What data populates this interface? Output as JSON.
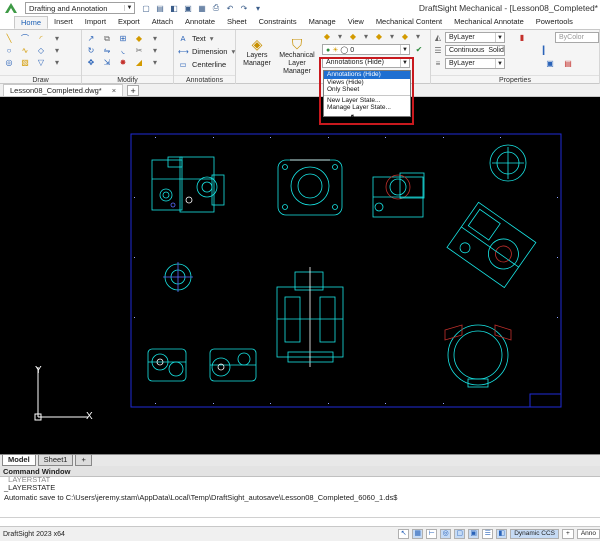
{
  "titlebar": {
    "workspace": "Drafting and Annotation",
    "window_title": "DraftSight Mechanical - [Lesson08_Completed*"
  },
  "ribbon_tabs": [
    "Home",
    "Insert",
    "Import",
    "Export",
    "Attach",
    "Annotate",
    "Sheet",
    "Constraints",
    "Manage",
    "View",
    "Mechanical Content",
    "Mechanical Annotate",
    "Powertools"
  ],
  "ribbon": {
    "draw_label": "Draw",
    "modify_label": "Modify",
    "annotations_label": "Annotations",
    "properties_label": "Properties",
    "text_label": "Text",
    "dimension_label": "Dimension",
    "centerline_label": "Centerline",
    "layers_manager_label": "Layers Manager",
    "mech_layer_manager_label": "Mechanical Layer Manager",
    "layer_combo_value": "0",
    "layer_state_value": "Annotations (Hide)",
    "color_value": "ByLayer",
    "linetype_value": "Continuous",
    "linestyle_value": "Solid",
    "lineweight_value": "ByLayer",
    "bycolor_value": "ByColor"
  },
  "layer_state_dropdown": {
    "items": [
      "Annotations (Hide)",
      "Views (Hide)",
      "Only Sheet",
      "New Layer State...",
      "Manage Layer State..."
    ],
    "selected_index": 0
  },
  "doc_tab": {
    "name": "Lesson08_Completed.dwg*",
    "close": "×",
    "add": "+"
  },
  "canvas": {
    "ucs_x": "X",
    "ucs_y": "Y"
  },
  "layout_tabs": [
    "Model",
    "Sheet1",
    "+"
  ],
  "command_window": {
    "title": "Command Window",
    "lines": [
      "_LAYERSTATE",
      "Automatic save to C:\\Users\\jeremy.stam\\AppData\\Local\\Temp\\DraftSight_autosave\\Lesson08_Completed_6060_1.ds$"
    ]
  },
  "statusbar": {
    "version": "DraftSight 2023 x64",
    "dynamic_ccs": "Dynamic CCS",
    "plus": "+",
    "anno": "Anno"
  },
  "colors": {
    "canvas_bg": "#000000",
    "frame": "#1f2bd6",
    "geometry": "#18e6e6",
    "highlight": "#c8191e",
    "selected": "#1f6fd1"
  }
}
